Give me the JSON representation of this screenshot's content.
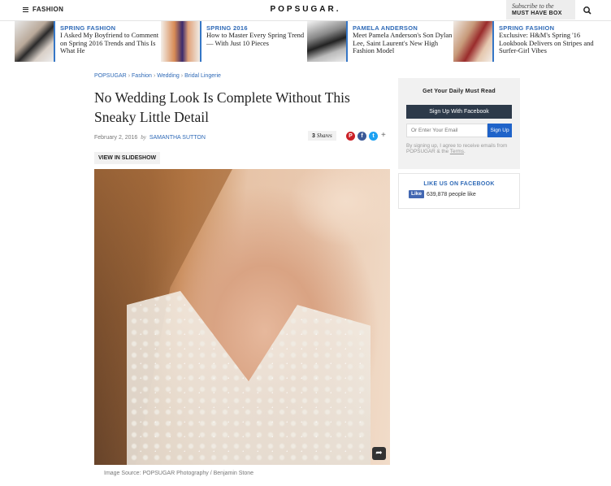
{
  "header": {
    "menu_label": "FASHION",
    "logo": "POPSUGAR.",
    "subscribe_line1": "Subscribe to the",
    "subscribe_line2": "MUST HAVE BOX"
  },
  "promos": [
    {
      "kicker": "SPRING FASHION",
      "title": "I Asked My Boyfriend to Comment on Spring 2016 Trends and This Is What He"
    },
    {
      "kicker": "SPRING 2016",
      "title": "How to Master Every Spring Trend — With Just 10 Pieces"
    },
    {
      "kicker": "PAMELA ANDERSON",
      "title": "Meet Pamela Anderson's Son Dylan Lee, Saint Laurent's New High Fashion Model"
    },
    {
      "kicker": "SPRING FASHION",
      "title": "Exclusive: H&M's Spring '16 Lookbook Delivers on Stripes and Surfer-Girl Vibes"
    }
  ],
  "article": {
    "breadcrumb": [
      "POPSUGAR",
      "Fashion",
      "Wedding",
      "Bridal Lingerie"
    ],
    "breadcrumb_sep": "›",
    "title": "No Wedding Look Is Complete Without This Sneaky Little Detail",
    "date": "February 2, 2016",
    "by": "by",
    "author": "SAMANTHA SUTTON",
    "shares_count": "3",
    "shares_label": "Shares",
    "slideshow_label": "VIEW IN SLIDESHOW",
    "caption": "Image Source: POPSUGAR Photography / Benjamin Stone"
  },
  "sidebar": {
    "newsletter_title": "Get Your Daily Must Read",
    "fb_signup_label": "Sign Up With Facebook",
    "email_placeholder": "Or Enter Your Email",
    "signup_label": "Sign Up",
    "legal_text": "By signing up, I agree to receive emails from POPSUGAR & the",
    "terms_label": "Terms",
    "legal_end": ".",
    "like_title": "LIKE US ON FACEBOOK",
    "like_button": "Like",
    "like_count": "639,878 people like"
  },
  "icons": {
    "menu": "hamburger-icon",
    "search": "search-icon",
    "pinterest": "pinterest-icon",
    "facebook": "facebook-icon",
    "twitter": "twitter-icon",
    "more": "plus-icon",
    "photo_share": "share-arrow-icon"
  },
  "colors": {
    "accent_blue": "#2f6ab7",
    "fb_dark": "#2d3a4a",
    "signup_blue": "#1f63c9",
    "pinterest": "#cb2027",
    "facebook": "#3b5998",
    "twitter": "#1da1f2"
  }
}
